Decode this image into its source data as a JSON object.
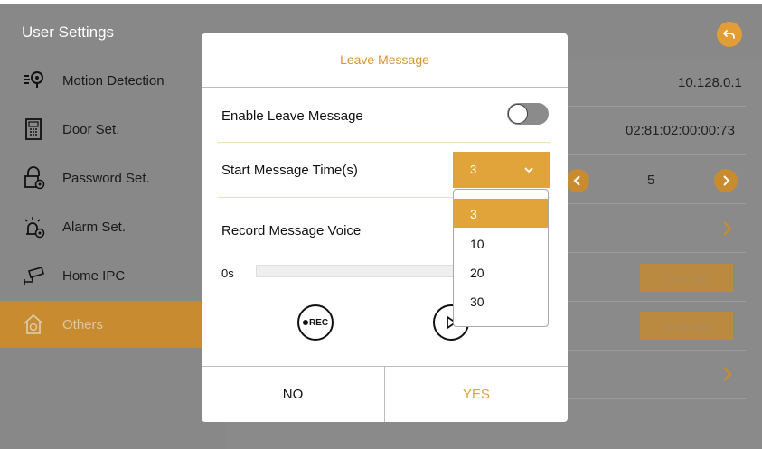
{
  "app": {
    "title": "User Settings",
    "back_icon": "undo-arrow-icon",
    "accent": "#e0a43a"
  },
  "sidebar": {
    "items": [
      {
        "label": "Motion Detection",
        "icon": "motion-detection-icon"
      },
      {
        "label": "Door Set.",
        "icon": "door-panel-icon"
      },
      {
        "label": "Password Set.",
        "icon": "password-lock-icon"
      },
      {
        "label": "Alarm Set.",
        "icon": "alarm-bell-icon"
      },
      {
        "label": "Home IPC",
        "icon": "security-camera-icon"
      },
      {
        "label": "Others",
        "icon": "home-settings-icon",
        "active": true
      }
    ]
  },
  "right_panel": {
    "ip_address": "10.128.0.1",
    "mac_address": "02:81:02:00:00:73",
    "stepper_value": "5",
    "format_label": "Format",
    "upgrade_label": "Upgrade"
  },
  "dialog": {
    "title": "Leave Message",
    "enable_label": "Enable Leave Message",
    "enable_on": false,
    "start_time_label": "Start Message Time(s)",
    "start_time_value": "3",
    "record_label": "Record Message Voice",
    "progress_text": "0s",
    "progress_fraction": 0.0,
    "rec_label": "REC",
    "no_label": "NO",
    "yes_label": "YES"
  },
  "dropdown": {
    "options": [
      "3",
      "10",
      "20",
      "30"
    ],
    "selected": "3"
  }
}
